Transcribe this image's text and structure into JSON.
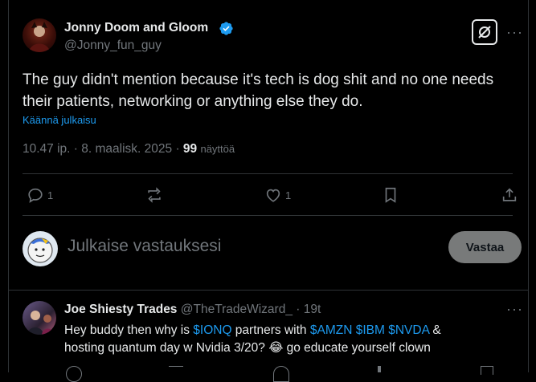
{
  "main_post": {
    "author_name": "Jonny Doom and Gloom",
    "author_handle": "@Jonny_fun_guy",
    "text": "The guy didn't mention because it's tech is dog shit and no one needs their patients, networking or anything else they do.",
    "translate_label": "Käännä julkaisu",
    "time": "10.47 ip.",
    "date": "8. maalisk. 2025",
    "views_count": "99",
    "views_label": "näyttöä",
    "stats": {
      "replies": "1",
      "reposts": "",
      "likes": "1"
    }
  },
  "reply_box": {
    "placeholder": "Julkaise vastauksesi",
    "button_label": "Vastaa"
  },
  "reply_post": {
    "author_name": "Joe Shiesty Trades",
    "author_handle": "@TheTradeWizard_",
    "time": "19t",
    "text_parts": {
      "a": "Hey buddy then why is ",
      "ionq": "$IONQ",
      "b": " partners with ",
      "amzn": "$AMZN",
      "ibm": "$IBM",
      "nvda": "$NVDA",
      "c": " &",
      "line2": "hosting quantum day w Nvidia 3/20? ",
      "emoji": "😂",
      "d": " go educate yourself clown"
    }
  },
  "colors": {
    "accent": "#1d9bf0",
    "muted": "#71767b",
    "divider": "#2f3336",
    "verified": "#1d9bf0"
  },
  "icons": [
    "verified-badge-icon",
    "grok-icon",
    "more-icon",
    "reply-icon",
    "repost-icon",
    "like-icon",
    "bookmark-icon",
    "share-icon"
  ]
}
